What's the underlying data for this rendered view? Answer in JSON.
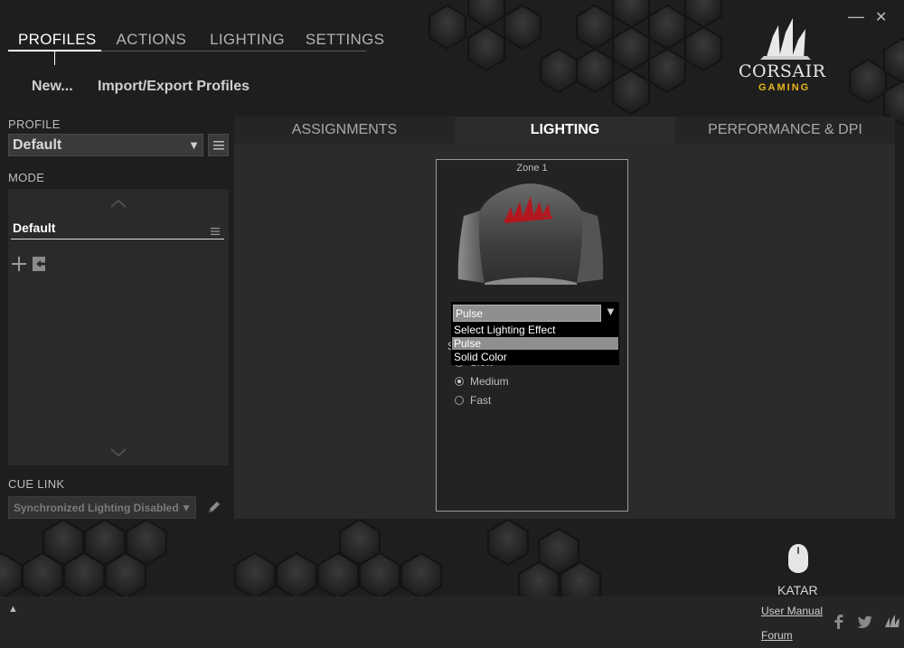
{
  "window": {
    "minimize_glyph": "—",
    "close_glyph": "✕"
  },
  "brand": {
    "name": "CORSAIR",
    "tagline": "GAMING",
    "accent_color": "#e8b51a"
  },
  "top_nav": {
    "tabs": [
      "PROFILES",
      "ACTIONS",
      "LIGHTING",
      "SETTINGS"
    ],
    "active_index": 0
  },
  "sub_nav": {
    "new_label": "New...",
    "import_export_label": "Import/Export Profiles"
  },
  "profile": {
    "section_label": "PROFILE",
    "selected": "Default"
  },
  "mode": {
    "section_label": "MODE",
    "items": [
      {
        "label": "Default",
        "selected": true
      }
    ]
  },
  "cue_link": {
    "section_label": "CUE LINK",
    "selected": "Synchronized Lighting Disabled"
  },
  "main_tabs": {
    "tabs": [
      "ASSIGNMENTS",
      "LIGHTING",
      "PERFORMANCE & DPI"
    ],
    "active_index": 1
  },
  "zone": {
    "title": "Zone 1",
    "logo_color": "#b3181e",
    "effect_select": {
      "selected": "Pulse",
      "options": [
        "Select Lighting Effect",
        "Pulse",
        "Solid Color"
      ],
      "highlighted_index": 1
    },
    "speed": {
      "partial_label": "S",
      "options": [
        "Slow",
        "Medium",
        "Fast"
      ],
      "selected_index": 1
    }
  },
  "device": {
    "name": "KATAR"
  },
  "footer": {
    "user_manual": "User Manual",
    "forum": "Forum",
    "expand_glyph": "▲"
  },
  "icons": {
    "add": "add-icon",
    "import": "import-icon",
    "menu": "menu-icon",
    "edit": "pencil-icon",
    "facebook": "facebook-icon",
    "twitter": "twitter-icon",
    "corsair": "corsair-sails-icon"
  }
}
